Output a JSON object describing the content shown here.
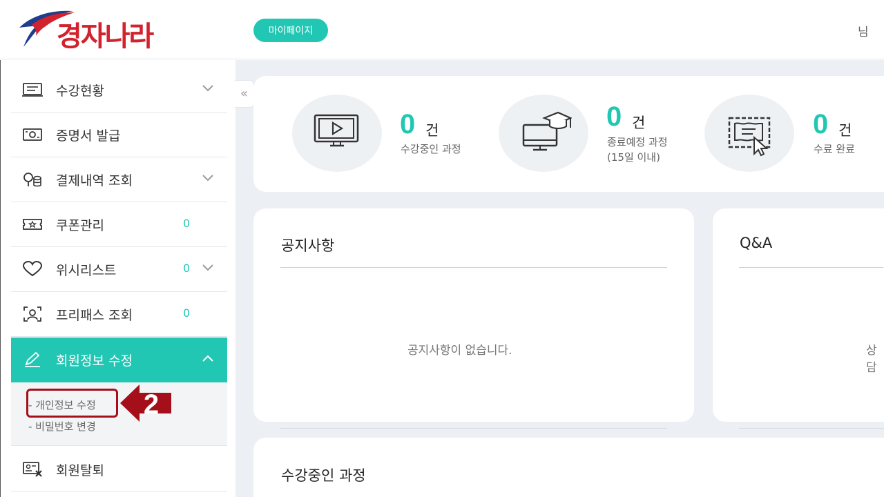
{
  "header": {
    "logo_text": "경자나라",
    "mypage_label": "마이페이지",
    "user_suffix": "님"
  },
  "sidebar": {
    "collapse_symbol": "«",
    "items": [
      {
        "label": "수강현황",
        "icon": "course-list-icon",
        "count": "",
        "chevron": true
      },
      {
        "label": "증명서 발급",
        "icon": "certificate-icon",
        "count": "",
        "chevron": false
      },
      {
        "label": "결제내역 조회",
        "icon": "payment-coins-icon",
        "count": "",
        "chevron": true
      },
      {
        "label": "쿠폰관리",
        "icon": "coupon-icon",
        "count": "0",
        "chevron": false
      },
      {
        "label": "위시리스트",
        "icon": "heart-icon",
        "count": "0",
        "chevron": true
      },
      {
        "label": "프리패스 조회",
        "icon": "freepass-user-icon",
        "count": "0",
        "chevron": false
      },
      {
        "label": "회원정보 수정",
        "icon": "pencil-icon",
        "count": "",
        "chevron": true
      },
      {
        "label": "회원탈퇴",
        "icon": "withdraw-card-icon",
        "count": "",
        "chevron": false
      }
    ],
    "submenu": [
      {
        "label": "- 개인정보 수정"
      },
      {
        "label": "- 비밀번호 변경"
      }
    ],
    "step_badge": "2"
  },
  "stats": [
    {
      "icon": "monitor-play-icon",
      "value": "0",
      "unit": "건",
      "label": "수강중인 과정",
      "label2": ""
    },
    {
      "icon": "graduation-monitor-icon",
      "value": "0",
      "unit": "건",
      "label": "종료예정 과정",
      "label2": "(15일 이내)"
    },
    {
      "icon": "certificate-click-icon",
      "value": "0",
      "unit": "건",
      "label": "수료 완료",
      "label2": ""
    }
  ],
  "panels": {
    "notice": {
      "title": "공지사항",
      "empty": "공지사항이 없습니다."
    },
    "qna": {
      "title": "Q&A",
      "empty": "상담"
    },
    "courses": {
      "title": "수강중인 과정"
    }
  },
  "colors": {
    "accent": "#22c7b4",
    "brand_red": "#d2222d",
    "highlight_red": "#a50f1a",
    "background": "#eceff3"
  }
}
